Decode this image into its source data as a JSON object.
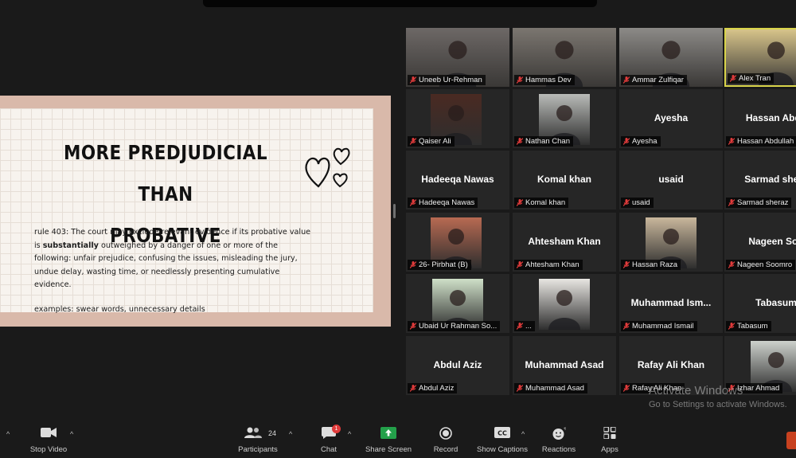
{
  "slide": {
    "title_line1": "MORE PREDJUDICIAL THAN",
    "title_line2": "PROBATIVE",
    "body_part1": "rule 403: The court may exclude relevant evidence if its probative value is ",
    "body_bold": "substantially",
    "body_part2": " outweighed by a danger of one or more of the following: unfair prejudice, confusing the issues, misleading the jury, undue delay, wasting time, or needlessly presenting cumulative evidence.",
    "examples": "examples: swear words, unnecessary details"
  },
  "participants": [
    {
      "name": "Uneeb Ur-Rehman",
      "display": "photo"
    },
    {
      "name": "Hammas Dev",
      "display": "photo"
    },
    {
      "name": "Ammar Zulfiqar",
      "display": "photo"
    },
    {
      "name": "Alex Tran",
      "display": "photo",
      "active": true
    },
    {
      "name": "Qaiser Ali",
      "display": "photo"
    },
    {
      "name": "Nathan Chan",
      "display": "photo"
    },
    {
      "name": "Ayesha",
      "display": "name",
      "center": "Ayesha"
    },
    {
      "name": "Hassan Abdullah",
      "display": "name",
      "center": "Hassan Abdu"
    },
    {
      "name": "Hadeeqa Nawas",
      "display": "name",
      "center": "Hadeeqa Nawas"
    },
    {
      "name": "Komal khan",
      "display": "name",
      "center": "Komal khan"
    },
    {
      "name": "usaid",
      "display": "name",
      "center": "usaid"
    },
    {
      "name": "Sarmad sheraz",
      "display": "name",
      "center": "Sarmad shera"
    },
    {
      "name": "26- Pirbhat (B)",
      "display": "photo"
    },
    {
      "name": "Ahtesham Khan",
      "display": "name",
      "center": "Ahtesham Khan"
    },
    {
      "name": "Hassan Raza",
      "display": "photo"
    },
    {
      "name": "Nageen Soomro",
      "display": "name",
      "center": "Nageen Soo"
    },
    {
      "name": "Ubaid Ur Rahman So...",
      "display": "photo"
    },
    {
      "name": "...",
      "display": "photo"
    },
    {
      "name": "Muhammad Ismail",
      "display": "name",
      "center": "Muhammad Ism..."
    },
    {
      "name": "Tabasum",
      "display": "name",
      "center": "Tabasum"
    },
    {
      "name": "Abdul Aziz",
      "display": "name",
      "center": "Abdul Aziz"
    },
    {
      "name": "Muhammad Asad",
      "display": "name",
      "center": "Muhammad Asad"
    },
    {
      "name": "Rafay Ali Khan",
      "display": "name",
      "center": "Rafay Ali Khan"
    },
    {
      "name": "Izhar Ahmad",
      "display": "photo"
    }
  ],
  "watermark": {
    "title": "Activate Windows",
    "subtitle": "Go to Settings to activate Windows."
  },
  "toolbar": {
    "stop_video": "Stop Video",
    "participants": "Participants",
    "participants_count": "24",
    "chat": "Chat",
    "chat_badge": "1",
    "share_screen": "Share Screen",
    "record": "Record",
    "captions": "Show Captions",
    "reactions": "Reactions",
    "apps": "Apps"
  },
  "colors": {
    "background": "#1a1a1a",
    "tile": "#262626",
    "active_border": "#d9d44a",
    "share_green": "#23a04a",
    "mute_red": "#e03b3b"
  }
}
